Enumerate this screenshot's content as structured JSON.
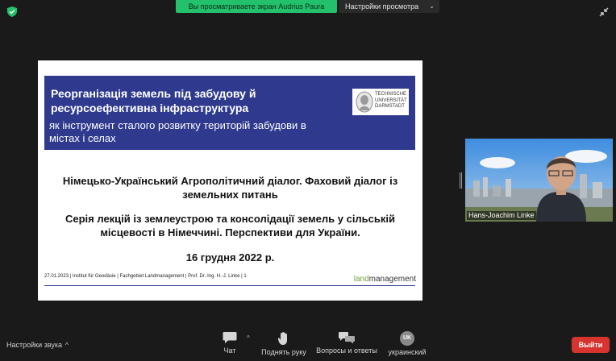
{
  "top": {
    "share_banner": "Вы просматриваете экран Audrius Paura",
    "view_settings": "Настройки просмотра"
  },
  "slide": {
    "title": "Реорганізація земель під забудову й ресурсоефективна інфраструктура",
    "subtitle": "як інструмент сталого розвитку територій забудови в містах і селах",
    "logo_text": [
      "TECHNISCHE",
      "UNIVERSITÄT",
      "DARMSTADT"
    ],
    "line1": "Німецько-Український Агрополітичний діалог. Фаховий діалог із земельних питань",
    "line2": "Серія лекцій із землеустрою та консолідації земель у сільській місцевості в Німеччині. Перспективи для України.",
    "date": "16 грудня 2022 р.",
    "footer": "27.01.2023  |  Institut für Geodäsie  |  Fachgebiet Landmanagement  |  Prof. Dr.-Ing. H.-J. Linke  |  1",
    "logo_land": "land",
    "logo_management": "management",
    "header_color": "#2f3a8f",
    "accent_color": "#6aa33c"
  },
  "participant": {
    "name": "Hans-Joachim Linke"
  },
  "toolbar": {
    "audio_settings": "Настройки звука",
    "chat": "Чат",
    "raise_hand": "Поднять руку",
    "qa": "Вопросы и ответы",
    "interpretation_badge": "UK",
    "interpretation": "украинский",
    "exit": "Выйти",
    "exit_color": "#d7342f"
  }
}
